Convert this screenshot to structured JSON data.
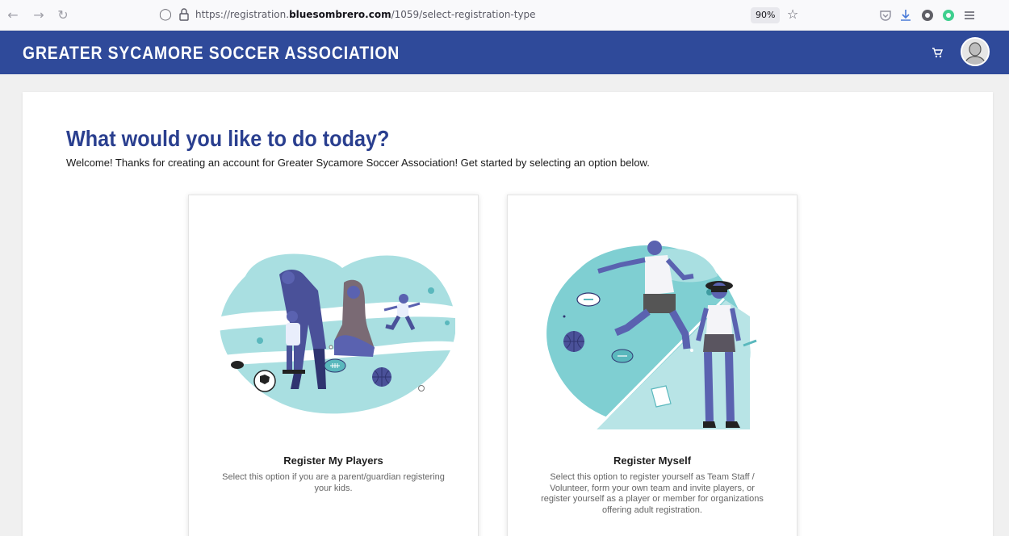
{
  "browser": {
    "url_prefix": "https://registration.",
    "url_domain": "bluesombrero.com",
    "url_path": "/1059/select-registration-type",
    "zoom": "90%"
  },
  "header": {
    "title": "GREATER SYCAMORE SOCCER ASSOCIATION"
  },
  "main": {
    "title": "What would you like to do today?",
    "welcome": "Welcome! Thanks for creating an account for Greater Sycamore Soccer Association! Get started by selecting an option below.",
    "options": [
      {
        "title": "Register My Players",
        "description": "Select this option if you are a parent/guardian registering your kids."
      },
      {
        "title": "Register Myself",
        "description": "Select this option to register yourself as Team Staff / Volunteer, form your own team and invite players, or register yourself as a player or member for organizations offering adult registration."
      }
    ]
  },
  "colors": {
    "brand": "#2f4a9a",
    "title": "#2a3f8f",
    "teal": "#7ecfd2",
    "figure": "#5a62b0"
  }
}
